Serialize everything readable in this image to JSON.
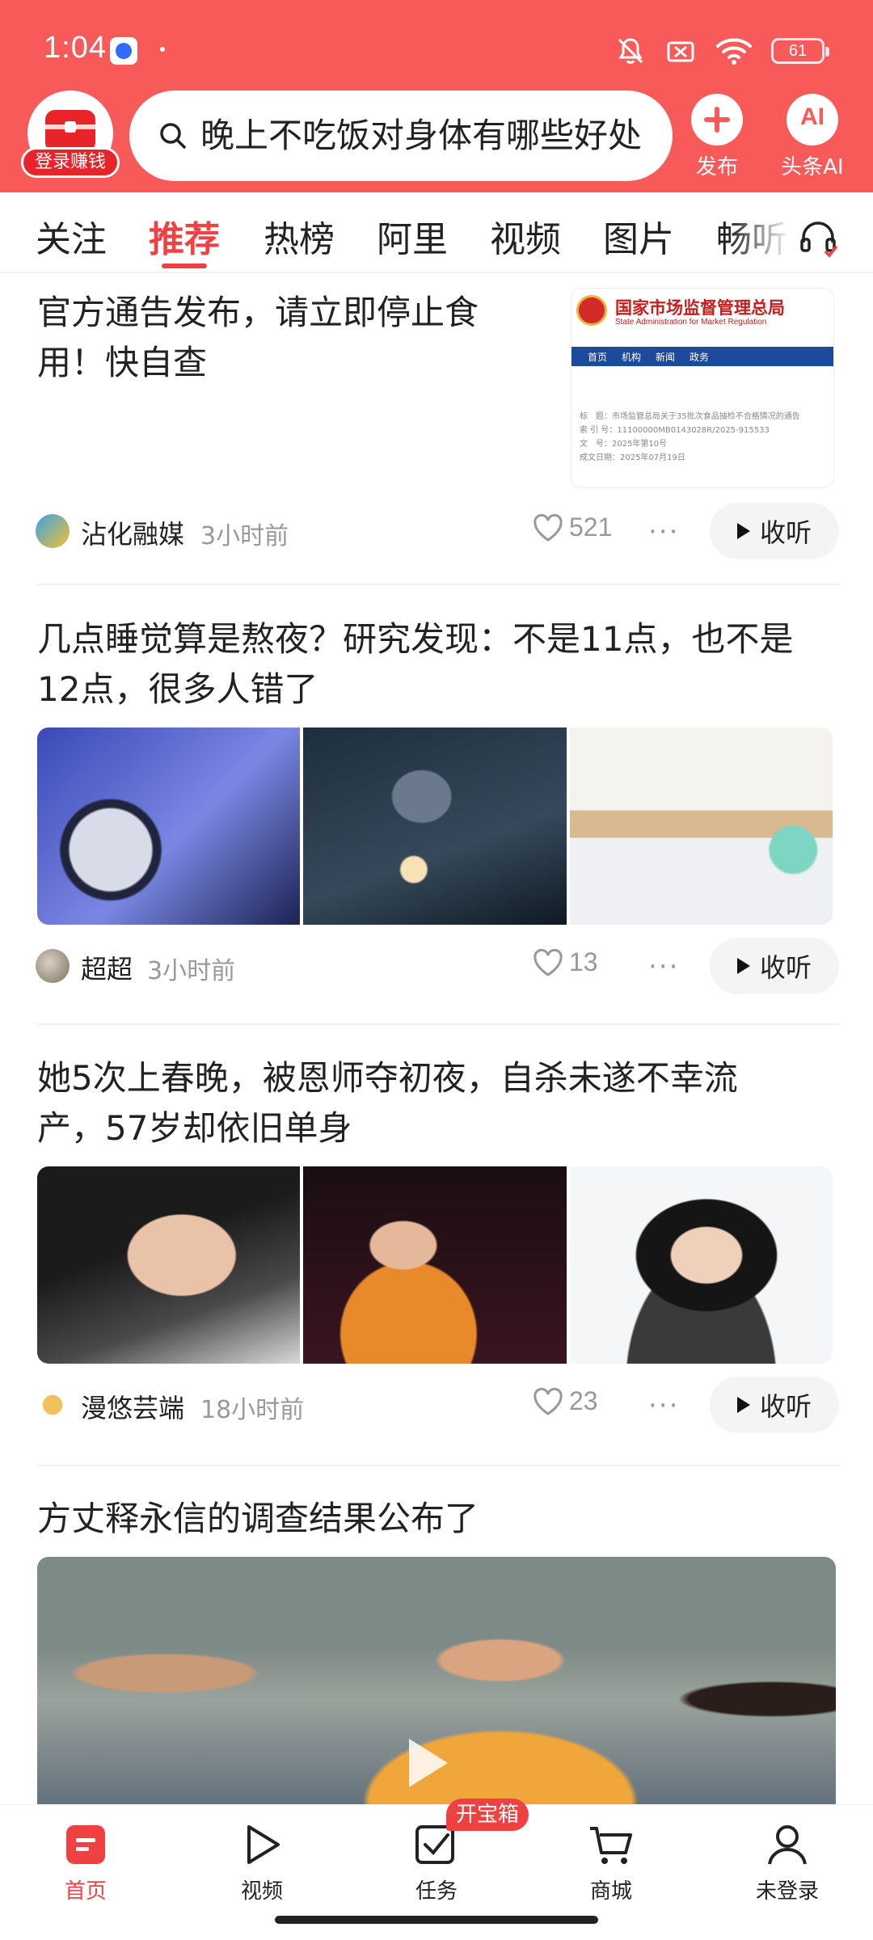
{
  "status_bar": {
    "time": "1:04",
    "battery": "61"
  },
  "header": {
    "login_badge": "登录赚钱",
    "search_text": "晚上不吃饭对身体有哪些好处",
    "publish_label": "发布",
    "ai_label": "头条AI",
    "ai_icon_text": "AI"
  },
  "tabs": [
    "关注",
    "推荐",
    "热榜",
    "阿里",
    "视频",
    "图片",
    "畅听"
  ],
  "active_tab": "推荐",
  "articles": [
    {
      "title_lines": [
        "官方通告发布，请立即停止食",
        "用！快自查"
      ],
      "author": "沾化融媒",
      "time_ago": "3小时前",
      "likes": "521",
      "listen": "收听",
      "thumb": {
        "org": "国家市场监督管理总局",
        "org_en": "State Administration for Market Regulation",
        "nav": [
          "首页",
          "机构",
          "新闻",
          "政务"
        ],
        "lines": [
          "标　题：市场监管总局关于35批次食品抽检不合格情况的通告",
          "索 引 号：11100000MB0143028R/2025-915533",
          "文　号：2025年第10号",
          "成文日期：2025年07月19日"
        ]
      }
    },
    {
      "title_lines": [
        "几点睡觉算是熬夜？研究发现：不是11点，也不是",
        "12点，很多人错了"
      ],
      "author": "超超",
      "time_ago": "3小时前",
      "likes": "13",
      "listen": "收听"
    },
    {
      "title_lines": [
        "她5次上春晚，被恩师夺初夜，自杀未遂不幸流",
        "产，57岁却依旧单身"
      ],
      "author": "漫悠芸端",
      "time_ago": "18小时前",
      "likes": "23",
      "listen": "收听"
    },
    {
      "title_lines": [
        "方丈释永信的调查结果公布了"
      ]
    }
  ],
  "bottom_nav": [
    "首页",
    "视频",
    "任务",
    "商城",
    "未登录"
  ],
  "treasure_badge": "开宝箱",
  "colors": {
    "brand_red": "#f85959",
    "active_red": "#f04142"
  }
}
